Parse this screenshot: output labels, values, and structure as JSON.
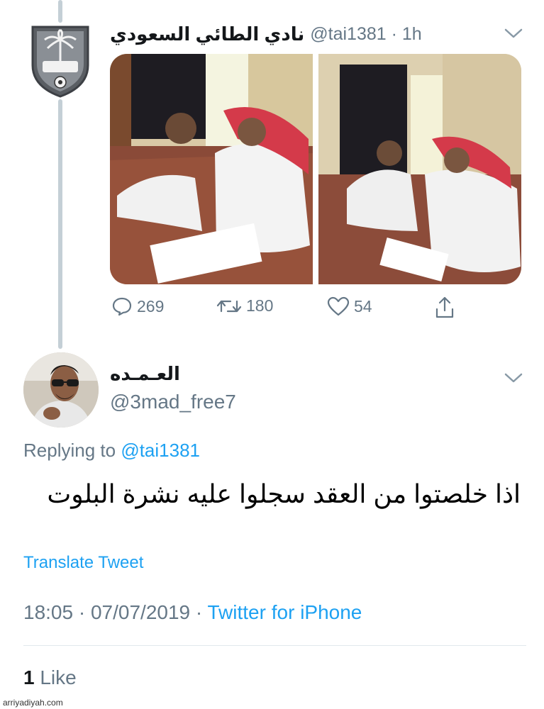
{
  "tweet": {
    "author_name": "نادي الطائي السعودي",
    "author_handle": "@tai1381",
    "separator": "·",
    "time_ago": "1h",
    "avatar_icon": "club-crest-icon",
    "stats": {
      "replies": "269",
      "retweets": "180",
      "likes": "54"
    }
  },
  "reply": {
    "author_name": "العـمـده",
    "author_handle": "@3mad_free7",
    "replying_to_label": "Replying to",
    "replying_to_handle": "@tai1381",
    "text": "اذا خلصتوا من العقد سجلوا عليه نشرة البلوت",
    "translate_label": "Translate Tweet",
    "time": "18:05",
    "date": "07/07/2019",
    "separator": "·",
    "source": "Twitter for iPhone",
    "like_count": "1",
    "like_label": "Like"
  },
  "watermark": "arriyadiyah.com",
  "colors": {
    "accent": "#1da1f2",
    "secondary_text": "#657786",
    "primary_text": "#14171a",
    "thread_line": "#c4cfd6"
  }
}
